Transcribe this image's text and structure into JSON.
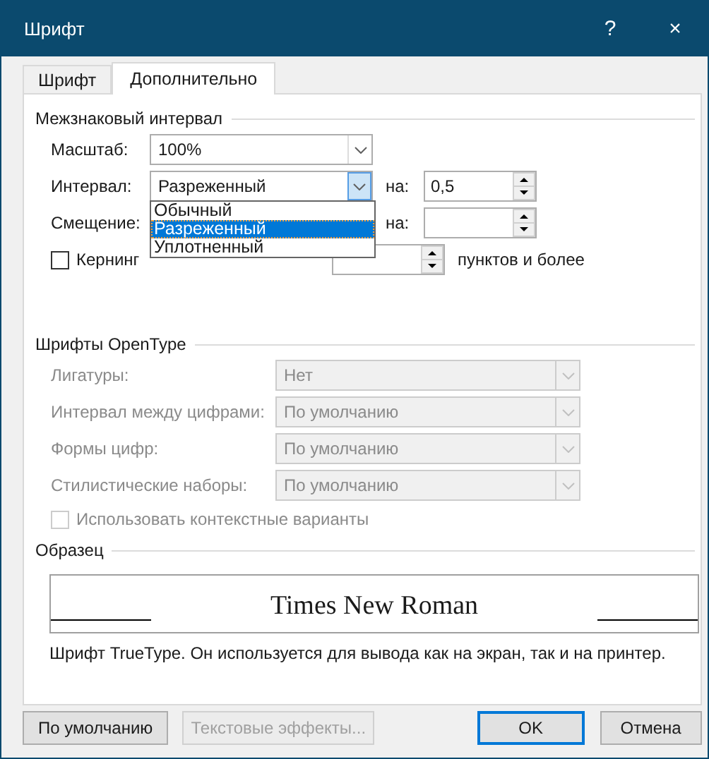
{
  "window": {
    "title": "Шрифт",
    "help": "?",
    "close": "×"
  },
  "tabs": [
    {
      "label": "Шрифт",
      "selected": false
    },
    {
      "label": "Дополнительно",
      "selected": true
    }
  ],
  "spacing_section": {
    "title": "Межзнаковый интервал",
    "scale": {
      "label": "Масштаб:",
      "value": "100%"
    },
    "spacing": {
      "label": "Интервал:",
      "value": "Разреженный",
      "expanded": true,
      "by_label": "на:",
      "by_value": "0,5",
      "options": [
        {
          "label": "Обычный",
          "selected": false
        },
        {
          "label": "Разреженный",
          "selected": true
        },
        {
          "label": "Уплотненный",
          "selected": false
        }
      ]
    },
    "position": {
      "label": "Смещение:",
      "by_label": "на:"
    },
    "kerning": {
      "label": "Кернинг",
      "checked": false,
      "suffix": "пунктов и более"
    }
  },
  "opentype_section": {
    "title": "Шрифты OpenType",
    "fields": [
      {
        "label": "Лигатуры:",
        "value": "Нет",
        "disabled": true
      },
      {
        "label": "Интервал между цифрами:",
        "value": "По умолчанию",
        "disabled": true
      },
      {
        "label": "Формы цифр:",
        "value": "По умолчанию",
        "disabled": true
      },
      {
        "label": "Стилистические наборы:",
        "value": "По умолчанию",
        "disabled": true
      }
    ],
    "contextual": {
      "label": "Использовать контекстные варианты",
      "checked": false,
      "disabled": true
    }
  },
  "preview_section": {
    "title": "Образец",
    "sample": "Times New Roman",
    "description": "Шрифт TrueType. Он используется для вывода как на экран, так и на принтер."
  },
  "buttons": [
    {
      "label": "По умолчанию",
      "disabled": false,
      "default": false
    },
    {
      "label": "Текстовые эффекты...",
      "disabled": true,
      "default": false
    },
    {
      "label": "OK",
      "disabled": false,
      "default": true
    },
    {
      "label": "Отмена",
      "disabled": false,
      "default": false
    }
  ]
}
